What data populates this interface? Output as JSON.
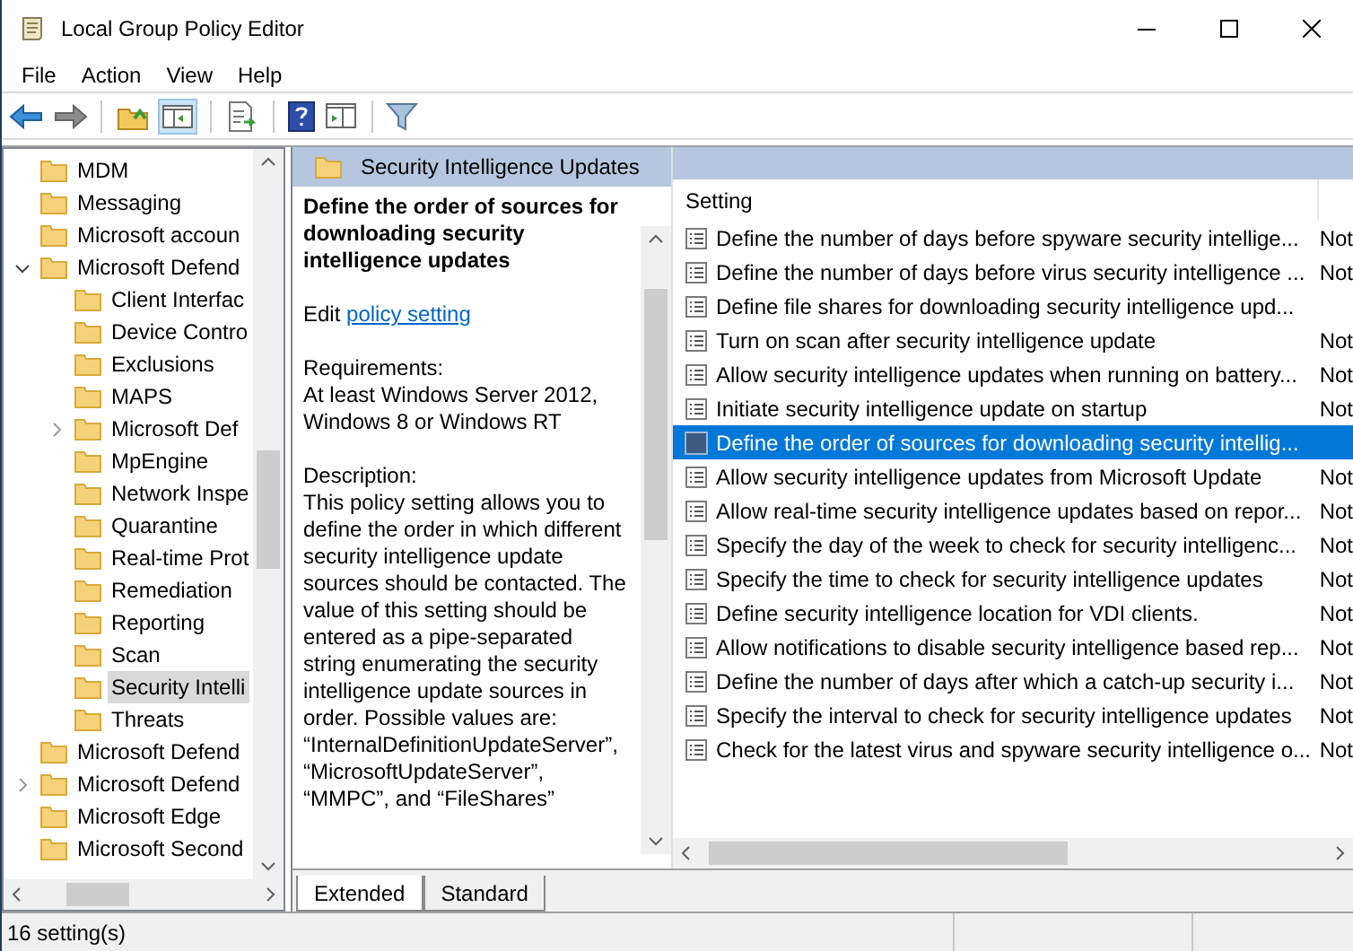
{
  "window": {
    "title": "Local Group Policy Editor"
  },
  "menu": [
    "File",
    "Action",
    "View",
    "Help"
  ],
  "tree": [
    {
      "label": "MDM"
    },
    {
      "label": "Messaging"
    },
    {
      "label": "Microsoft accoun"
    },
    {
      "label": "Microsoft Defend",
      "expanded": true,
      "children": [
        {
          "label": "Client Interfac"
        },
        {
          "label": "Device Contro"
        },
        {
          "label": "Exclusions"
        },
        {
          "label": "MAPS"
        },
        {
          "label": "Microsoft Def",
          "expanded": false
        },
        {
          "label": "MpEngine"
        },
        {
          "label": "Network Inspe"
        },
        {
          "label": "Quarantine"
        },
        {
          "label": "Real-time Prot"
        },
        {
          "label": "Remediation"
        },
        {
          "label": "Reporting"
        },
        {
          "label": "Scan"
        },
        {
          "label": "Security Intelli",
          "selected": true
        },
        {
          "label": "Threats"
        }
      ]
    },
    {
      "label": "Microsoft Defend"
    },
    {
      "label": "Microsoft Defend",
      "expanded": false
    },
    {
      "label": "Microsoft Edge"
    },
    {
      "label": "Microsoft Second"
    }
  ],
  "header": {
    "title": "Security Intelligence Updates"
  },
  "details": {
    "title": "Define the order of sources for downloading security intelligence updates",
    "edit_prefix": "Edit",
    "edit_link": "policy setting",
    "requirements_label": "Requirements:",
    "requirements": "At least Windows Server 2012, Windows 8 or Windows RT",
    "description_label": "Description:",
    "description": "This policy setting allows you to define the order in which different security intelligence update sources should be contacted. The value of this setting should be entered as a pipe-separated string enumerating the security intelligence update sources in order. Possible values are: “InternalDefinitionUpdateServer”, “MicrosoftUpdateServer”, “MMPC”, and “FileShares”"
  },
  "table": {
    "columns": [
      "Setting"
    ],
    "rows": [
      {
        "setting": "Define the number of days before spyware security intellige...",
        "column_2": "Not",
        "selected": false
      },
      {
        "setting": "Define the number of days before virus security intelligence ...",
        "column_2": "Not",
        "selected": false
      },
      {
        "setting": "Define file shares for downloading security intelligence upd...",
        "selected": false
      },
      {
        "setting": "Turn on scan after security intelligence update",
        "column_2": "Not",
        "selected": false
      },
      {
        "setting": "Allow security intelligence updates when running on battery...",
        "column_2": "Not",
        "selected": false
      },
      {
        "setting": "Initiate security intelligence update on startup",
        "column_2": "Not",
        "selected": false
      },
      {
        "setting": "Define the order of sources for downloading security intellig...",
        "selected": true
      },
      {
        "setting": "Allow security intelligence updates from Microsoft Update",
        "column_2": "Not",
        "selected": false
      },
      {
        "setting": "Allow real-time security intelligence updates based on repor...",
        "column_2": "Not",
        "selected": false
      },
      {
        "setting": "Specify the day of the week to check for security intelligenc...",
        "column_2": "Not",
        "selected": false
      },
      {
        "setting": "Specify the time to check for security intelligence updates",
        "column_2": "Not",
        "selected": false
      },
      {
        "setting": "Define security intelligence location for VDI clients.",
        "column_2": "Not",
        "selected": false
      },
      {
        "setting": "Allow notifications to disable security intelligence based rep...",
        "column_2": "Not",
        "selected": false
      },
      {
        "setting": "Define the number of days after which a catch-up security i...",
        "column_2": "Not",
        "selected": false
      },
      {
        "setting": "Specify the interval to check for security intelligence updates",
        "column_2": "Not",
        "selected": false
      },
      {
        "setting": "Check for the latest virus and spyware security intelligence o...",
        "column_2": "Not",
        "selected": false
      }
    ]
  },
  "tabs": [
    {
      "label": "Extended",
      "selected": true
    },
    {
      "label": "Standard",
      "selected": false
    }
  ],
  "status_bar": {
    "text": "16 setting(s)"
  }
}
